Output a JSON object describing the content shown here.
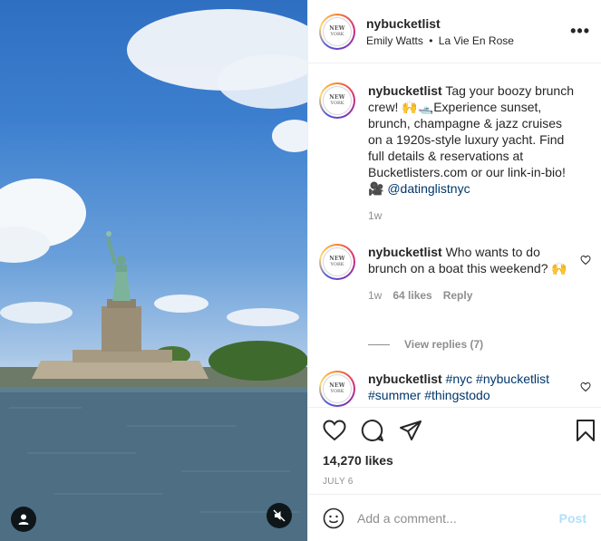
{
  "post": {
    "username": "nybucketlist",
    "subtitle_user": "Emily Watts",
    "subtitle_sep": "•",
    "subtitle_song": "La Vie En Rose",
    "more_label": "•••",
    "avatar_line1": "NEW",
    "avatar_line2": "YORK"
  },
  "caption": {
    "username": "nybucketlist",
    "text": "Tag your boozy brunch crew! 🙌🛥️Experience sunset, brunch, champagne & jazz cruises on a 1920s-style luxury yacht. Find full details & reservations at Bucketlisters.com or our link-in-bio! 🎥 ",
    "mention": "@datinglistnyc",
    "time": "1w"
  },
  "comments": [
    {
      "username": "nybucketlist",
      "text": "Who wants to do brunch on a boat this weekend? 🙌",
      "time": "1w",
      "likes": "64 likes",
      "reply": "Reply",
      "view_replies": "View replies (7)"
    },
    {
      "username": "nybucketlist",
      "tags": "#nyc #nybucketlist #summer #thingstodo"
    }
  ],
  "actions": {
    "likes": "14,270 likes",
    "date": "JULY 6"
  },
  "composer": {
    "placeholder": "Add a comment...",
    "post_label": "Post"
  },
  "colors": {
    "link": "#00376b",
    "muted": "#8e8e8e",
    "post_disabled": "#b2dffc"
  }
}
